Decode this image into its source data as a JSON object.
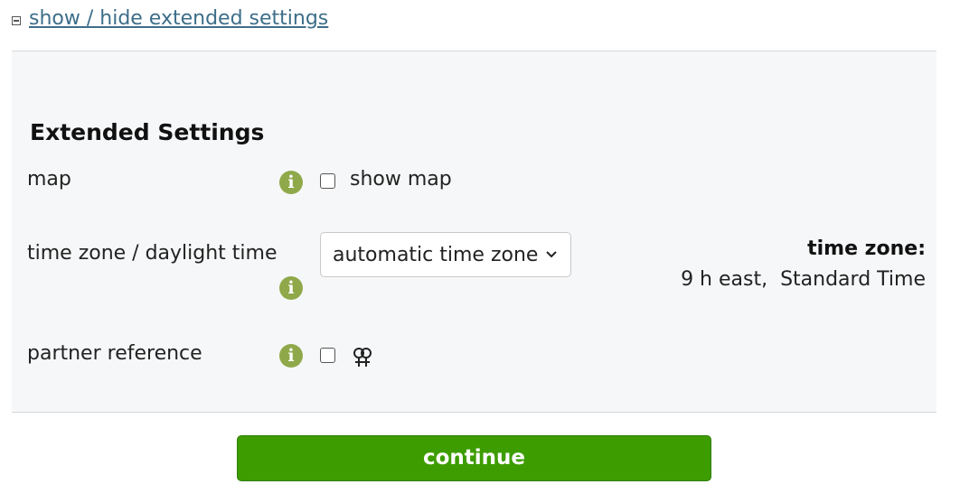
{
  "toggle": {
    "link_text": "show / hide extended settings",
    "icon": "collapse-minus-icon"
  },
  "panel": {
    "heading": "Extended Settings",
    "map": {
      "label": "map",
      "checkbox_label": "show map",
      "checked": false,
      "info_icon": "info-icon"
    },
    "timezone": {
      "label": "time zone / daylight time",
      "selected": "automatic time zone",
      "info_icon": "info-icon",
      "summary_title": "time zone:",
      "summary_value": "9 h east,  Standard Time"
    },
    "partner": {
      "label": "partner reference",
      "checked": false,
      "symbol_icon": "double-venus-icon",
      "info_icon": "info-icon"
    }
  },
  "continue": {
    "label": "continue"
  },
  "colors": {
    "link": "#3d6e8a",
    "info": "#8fa94a",
    "button": "#3d9c00",
    "panel_bg": "#f6f7f8"
  }
}
